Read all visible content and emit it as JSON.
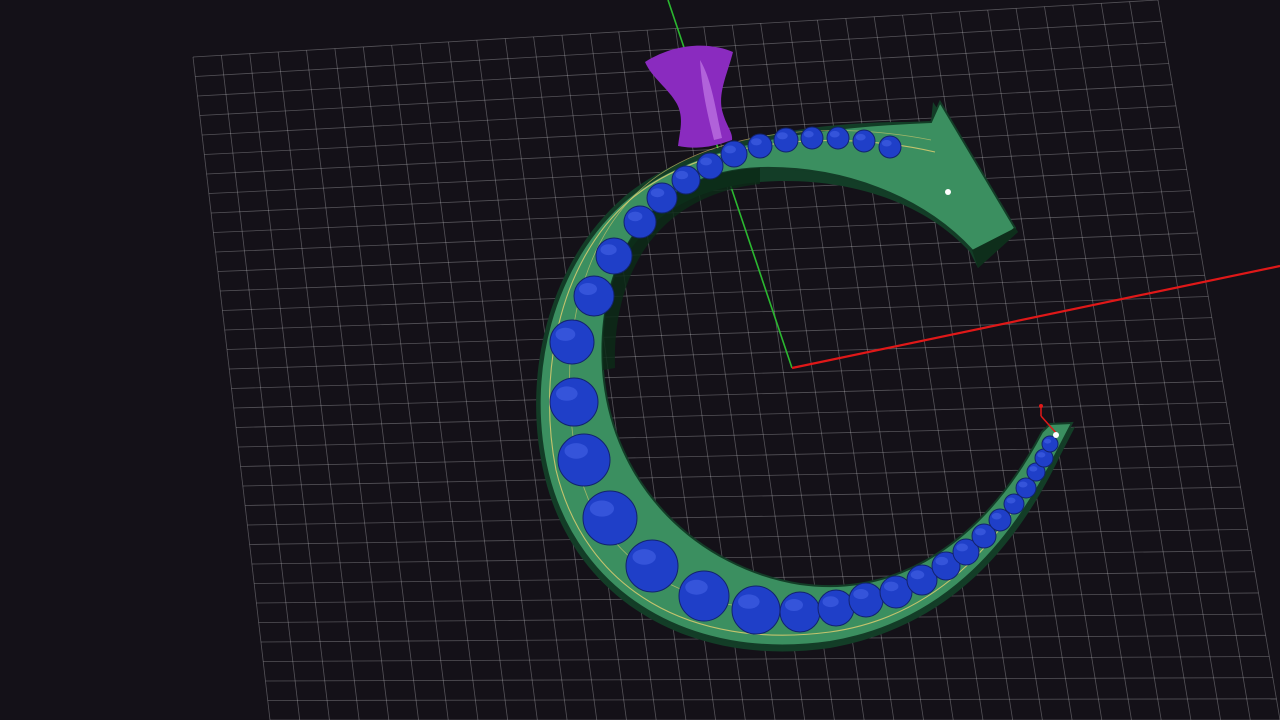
{
  "viewport": {
    "background_color": "#141118",
    "grid_color": "#d8d8dc",
    "x_axis_color": "#e01818",
    "y_axis_color": "#2bb830"
  },
  "model": {
    "ring_color": "#2f7a52",
    "ring_edge_color": "#133d27",
    "ring_top_color": "#3b8f60",
    "gem_color": "#1f3fc8",
    "prong_color": "#8a2bbf",
    "guide_line_color": "#e6d070"
  }
}
